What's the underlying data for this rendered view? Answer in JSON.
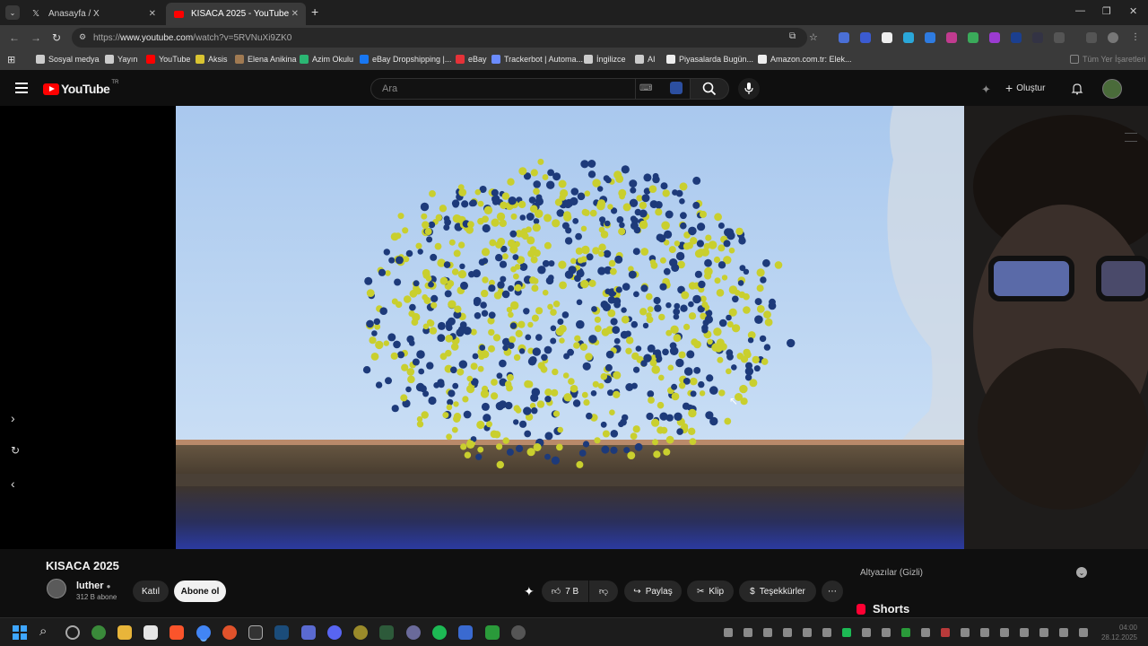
{
  "browser": {
    "tabs": [
      {
        "label": "Anasayfa / X",
        "icon": "x-logo-icon"
      },
      {
        "label": "KISACA 2025 - YouTube",
        "icon": "youtube-icon"
      }
    ],
    "new_tab": "+",
    "url_prefix": "https://",
    "url_domain": "www.youtube.com",
    "url_path": "/watch?v=5RVNuXi9ZK0"
  },
  "bookmarks": [
    {
      "label": "Sosyal medya",
      "color": "#cccccc"
    },
    {
      "label": "Yayın",
      "color": "#cccccc"
    },
    {
      "label": "YouTube",
      "color": "#ff0000"
    },
    {
      "label": "Aksis",
      "color": "#d9c431"
    },
    {
      "label": "Elena Anikina",
      "color": "#a07a52"
    },
    {
      "label": "Azim Okulu",
      "color": "#2bb673"
    },
    {
      "label": "eBay Dropshipping |...",
      "color": "#1877f2"
    },
    {
      "label": "eBay",
      "color": "#e53238"
    },
    {
      "label": "Trackerbot | Automa...",
      "color": "#6b8cff"
    },
    {
      "label": "İngilizce",
      "color": "#cccccc"
    },
    {
      "label": "AI",
      "color": "#cccccc"
    },
    {
      "label": "Piyasalarda Bugün...",
      "color": "#eeeeee"
    },
    {
      "label": "Amazon.com.tr: Elek...",
      "color": "#eeeeee"
    }
  ],
  "bookmarks_all": "Tüm Yer İşaretleri",
  "youtube": {
    "logo_text": "YouTube",
    "logo_region": "TR",
    "search_placeholder": "Ara",
    "create_label": "Oluştur"
  },
  "video": {
    "title": "KISACA 2025",
    "channel": "luther",
    "subscribers": "312 B abone",
    "join_label": "Katıl",
    "subscribe_label": "Abone ol",
    "likes": "7 B",
    "share_label": "Paylaş",
    "clip_label": "Klip",
    "thanks_label": "Teşekkürler",
    "balloon_colors": [
      "#1d3a7a",
      "#c9cf2e"
    ]
  },
  "sidebar": {
    "captions_label": "Altyazılar (Gizli)",
    "shorts_label": "Shorts"
  },
  "taskbar": {
    "clock_time": "04:00",
    "clock_date": "28.12.2025"
  }
}
